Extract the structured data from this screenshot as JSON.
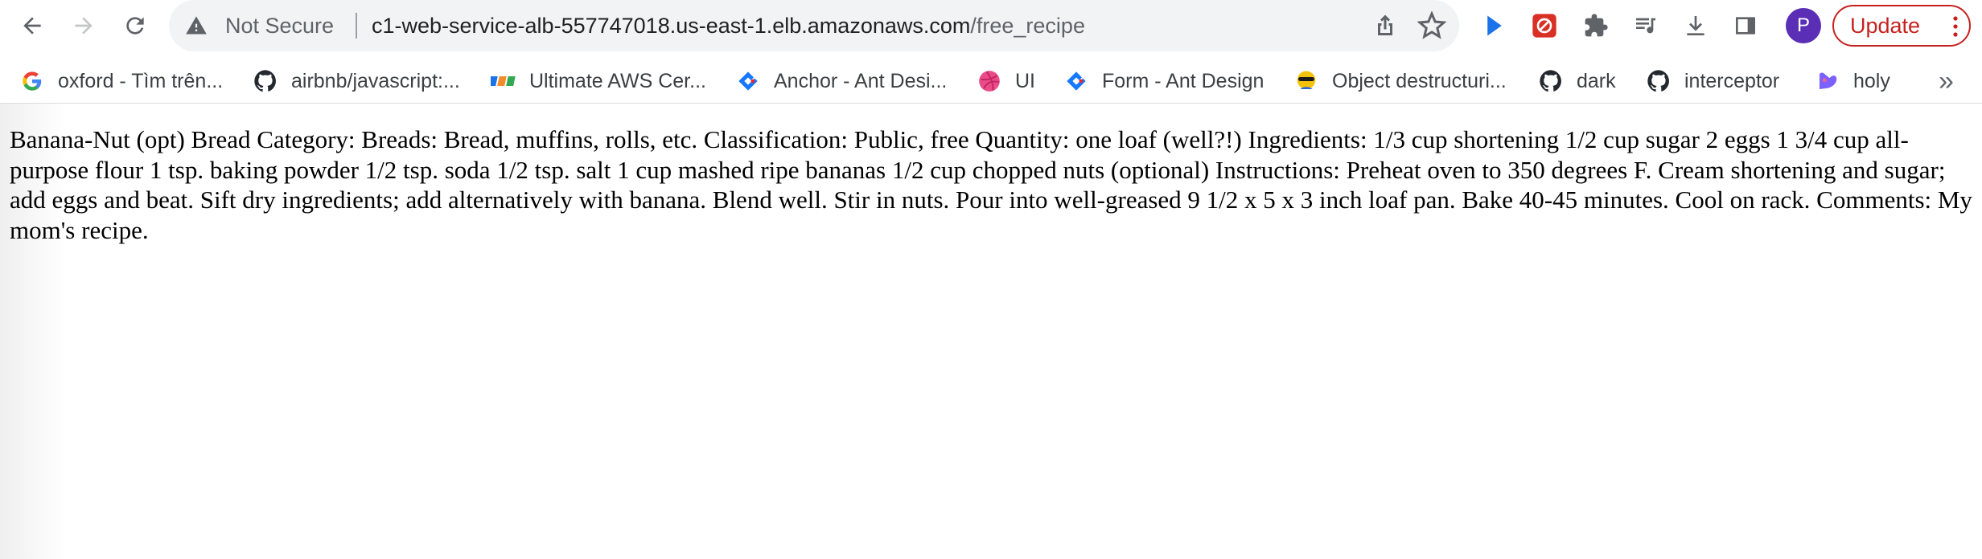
{
  "toolbar": {
    "security_label": "Not Secure",
    "url_host": "c1-web-service-alb-557747018.us-east-1.elb.amazonaws.com",
    "url_path": "/free_recipe",
    "avatar_initial": "P",
    "update_label": "Update",
    "colors": {
      "update": "#c5221f",
      "avatar": "#5b2fb5",
      "omnibox": "#f1f3f4"
    }
  },
  "bookmarks": [
    {
      "label": "oxford - Tìm trên...",
      "icon": "google-icon"
    },
    {
      "label": "airbnb/javascript:...",
      "icon": "github-icon"
    },
    {
      "label": "Ultimate AWS Cer...",
      "icon": "fpt-icon"
    },
    {
      "label": "Anchor - Ant Desi...",
      "icon": "ant-design-icon"
    },
    {
      "label": "UI",
      "icon": "dribbble-icon"
    },
    {
      "label": "Form - Ant Design",
      "icon": "ant-design-icon"
    },
    {
      "label": "Object destructuri...",
      "icon": "mdn-icon"
    },
    {
      "label": "dark",
      "icon": "github-icon"
    },
    {
      "label": "interceptor",
      "icon": "github-icon"
    },
    {
      "label": "holy",
      "icon": "kapwing-icon"
    }
  ],
  "bookmarks_more": "»",
  "page": {
    "recipe_text": "Banana-Nut (opt) Bread Category: Breads: Bread, muffins, rolls, etc. Classification: Public, free Quantity: one loaf (well?!) Ingredients: 1/3 cup shortening 1/2 cup sugar 2 eggs 1 3/4 cup all-purpose flour 1 tsp. baking powder 1/2 tsp. soda 1/2 tsp. salt 1 cup mashed ripe bananas 1/2 cup chopped nuts (optional) Instructions: Preheat oven to 350 degrees F. Cream shortening and sugar; add eggs and beat. Sift dry ingredients; add alternatively with banana. Blend well. Stir in nuts. Pour into well-greased 9 1/2 x 5 x 3 inch loaf pan. Bake 40-45 minutes. Cool on rack. Comments: My mom's recipe."
  }
}
